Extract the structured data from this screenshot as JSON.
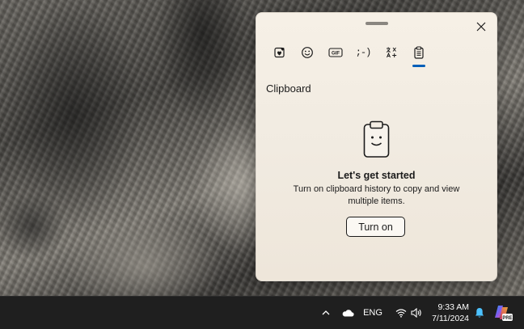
{
  "panel": {
    "section_title": "Clipboard",
    "tabs": [
      {
        "name": "favorites-icon",
        "active": false
      },
      {
        "name": "emoji-icon",
        "active": false
      },
      {
        "name": "gif-icon",
        "active": false,
        "label": "GIF"
      },
      {
        "name": "kaomoji-icon",
        "active": false,
        "label": ";-)"
      },
      {
        "name": "symbols-icon",
        "active": false
      },
      {
        "name": "clipboard-icon",
        "active": true
      }
    ],
    "empty_state": {
      "heading": "Let's get started",
      "description": "Turn on clipboard history to copy and view multiple items.",
      "button_label": "Turn on"
    }
  },
  "taskbar": {
    "language": "ENG",
    "time": "9:33 AM",
    "date": "7/11/2024",
    "copilot_badge": "PRE"
  },
  "colors": {
    "accent": "#005fb8",
    "panel_bg": "#f3ede3",
    "taskbar_bg": "#1f1f1f"
  }
}
